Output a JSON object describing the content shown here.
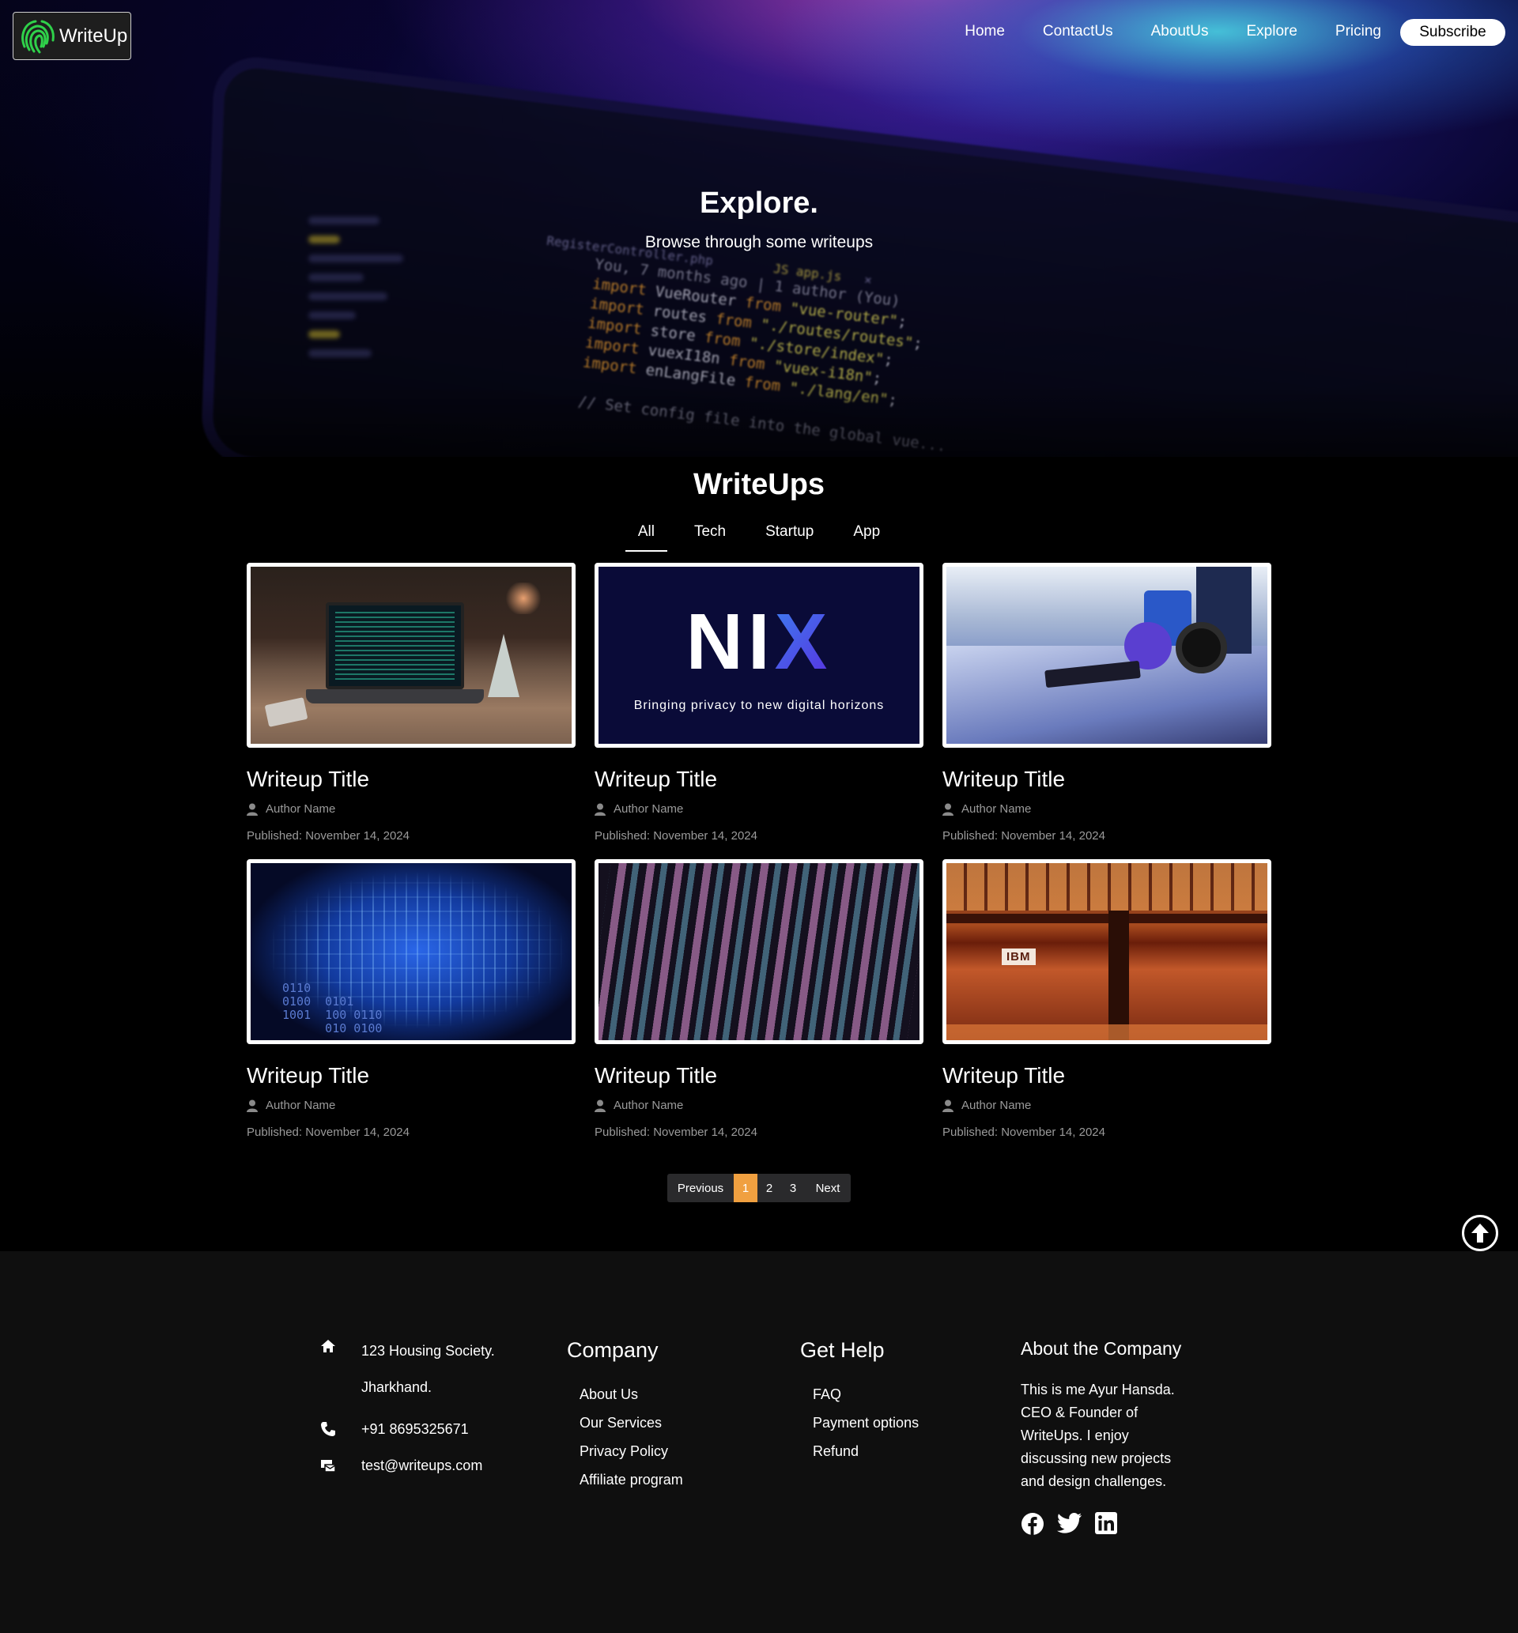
{
  "header": {
    "logo_text": "WriteUp",
    "nav": [
      "Home",
      "ContactUs",
      "AboutUs",
      "Explore",
      "Pricing"
    ],
    "subscribe_label": "Subscribe"
  },
  "hero": {
    "title": "Explore.",
    "subtitle": "Browse through some writeups"
  },
  "writeups": {
    "title": "WriteUps",
    "tabs": [
      "All",
      "Tech",
      "Startup",
      "App"
    ],
    "active_tab": "All",
    "cards": [
      {
        "title": "Writeup Title",
        "author": "Author Name",
        "published": "Published: November 14, 2024",
        "image": "laptop-on-desk"
      },
      {
        "title": "Writeup Title",
        "author": "Author Name",
        "published": "Published: November 14, 2024",
        "image": "nix-logo",
        "image_text": {
          "logo": "NIX",
          "tagline": "Bringing privacy to new digital horizons"
        }
      },
      {
        "title": "Writeup Title",
        "author": "Author Name",
        "published": "Published: November 14, 2024",
        "image": "headphones-on-windowsill"
      },
      {
        "title": "Writeup Title",
        "author": "Author Name",
        "published": "Published: November 14, 2024",
        "image": "circuit-brain",
        "image_text": {
          "bits": "0110\n0100  0101\n1001  100 0110\n      010 0100"
        }
      },
      {
        "title": "Writeup Title",
        "author": "Author Name",
        "published": "Published: November 14, 2024",
        "image": "office-building-night"
      },
      {
        "title": "Writeup Title",
        "author": "Author Name",
        "published": "Published: November 14, 2024",
        "image": "ibm-office",
        "image_text": {
          "sign": "IBM"
        }
      }
    ]
  },
  "pagination": {
    "prev_label": "Previous",
    "pages": [
      "1",
      "2",
      "3"
    ],
    "current_page": "1",
    "next_label": "Next"
  },
  "footer": {
    "address_line1": "123 Housing Society.",
    "address_line2": "Jharkhand.",
    "phone": "+91 8695325671",
    "email": "test@writeups.com",
    "company": {
      "heading": "Company",
      "links": [
        "About Us",
        "Our Services",
        "Privacy Policy",
        "Affiliate program"
      ]
    },
    "help": {
      "heading": "Get Help",
      "links": [
        "FAQ",
        "Payment options",
        "Refund"
      ]
    },
    "about": {
      "heading": "About the Company",
      "text": "This is me Ayur Hansda. CEO & Founder of WriteUps. I enjoy discussing new projects and design challenges."
    },
    "socials": [
      "facebook-icon",
      "twitter-icon",
      "linkedin-icon"
    ]
  },
  "colors": {
    "background": "#000000",
    "footer_bg": "#0f0f0f",
    "pagination_active": "#f0a040",
    "muted_text": "#9a9a9a"
  }
}
